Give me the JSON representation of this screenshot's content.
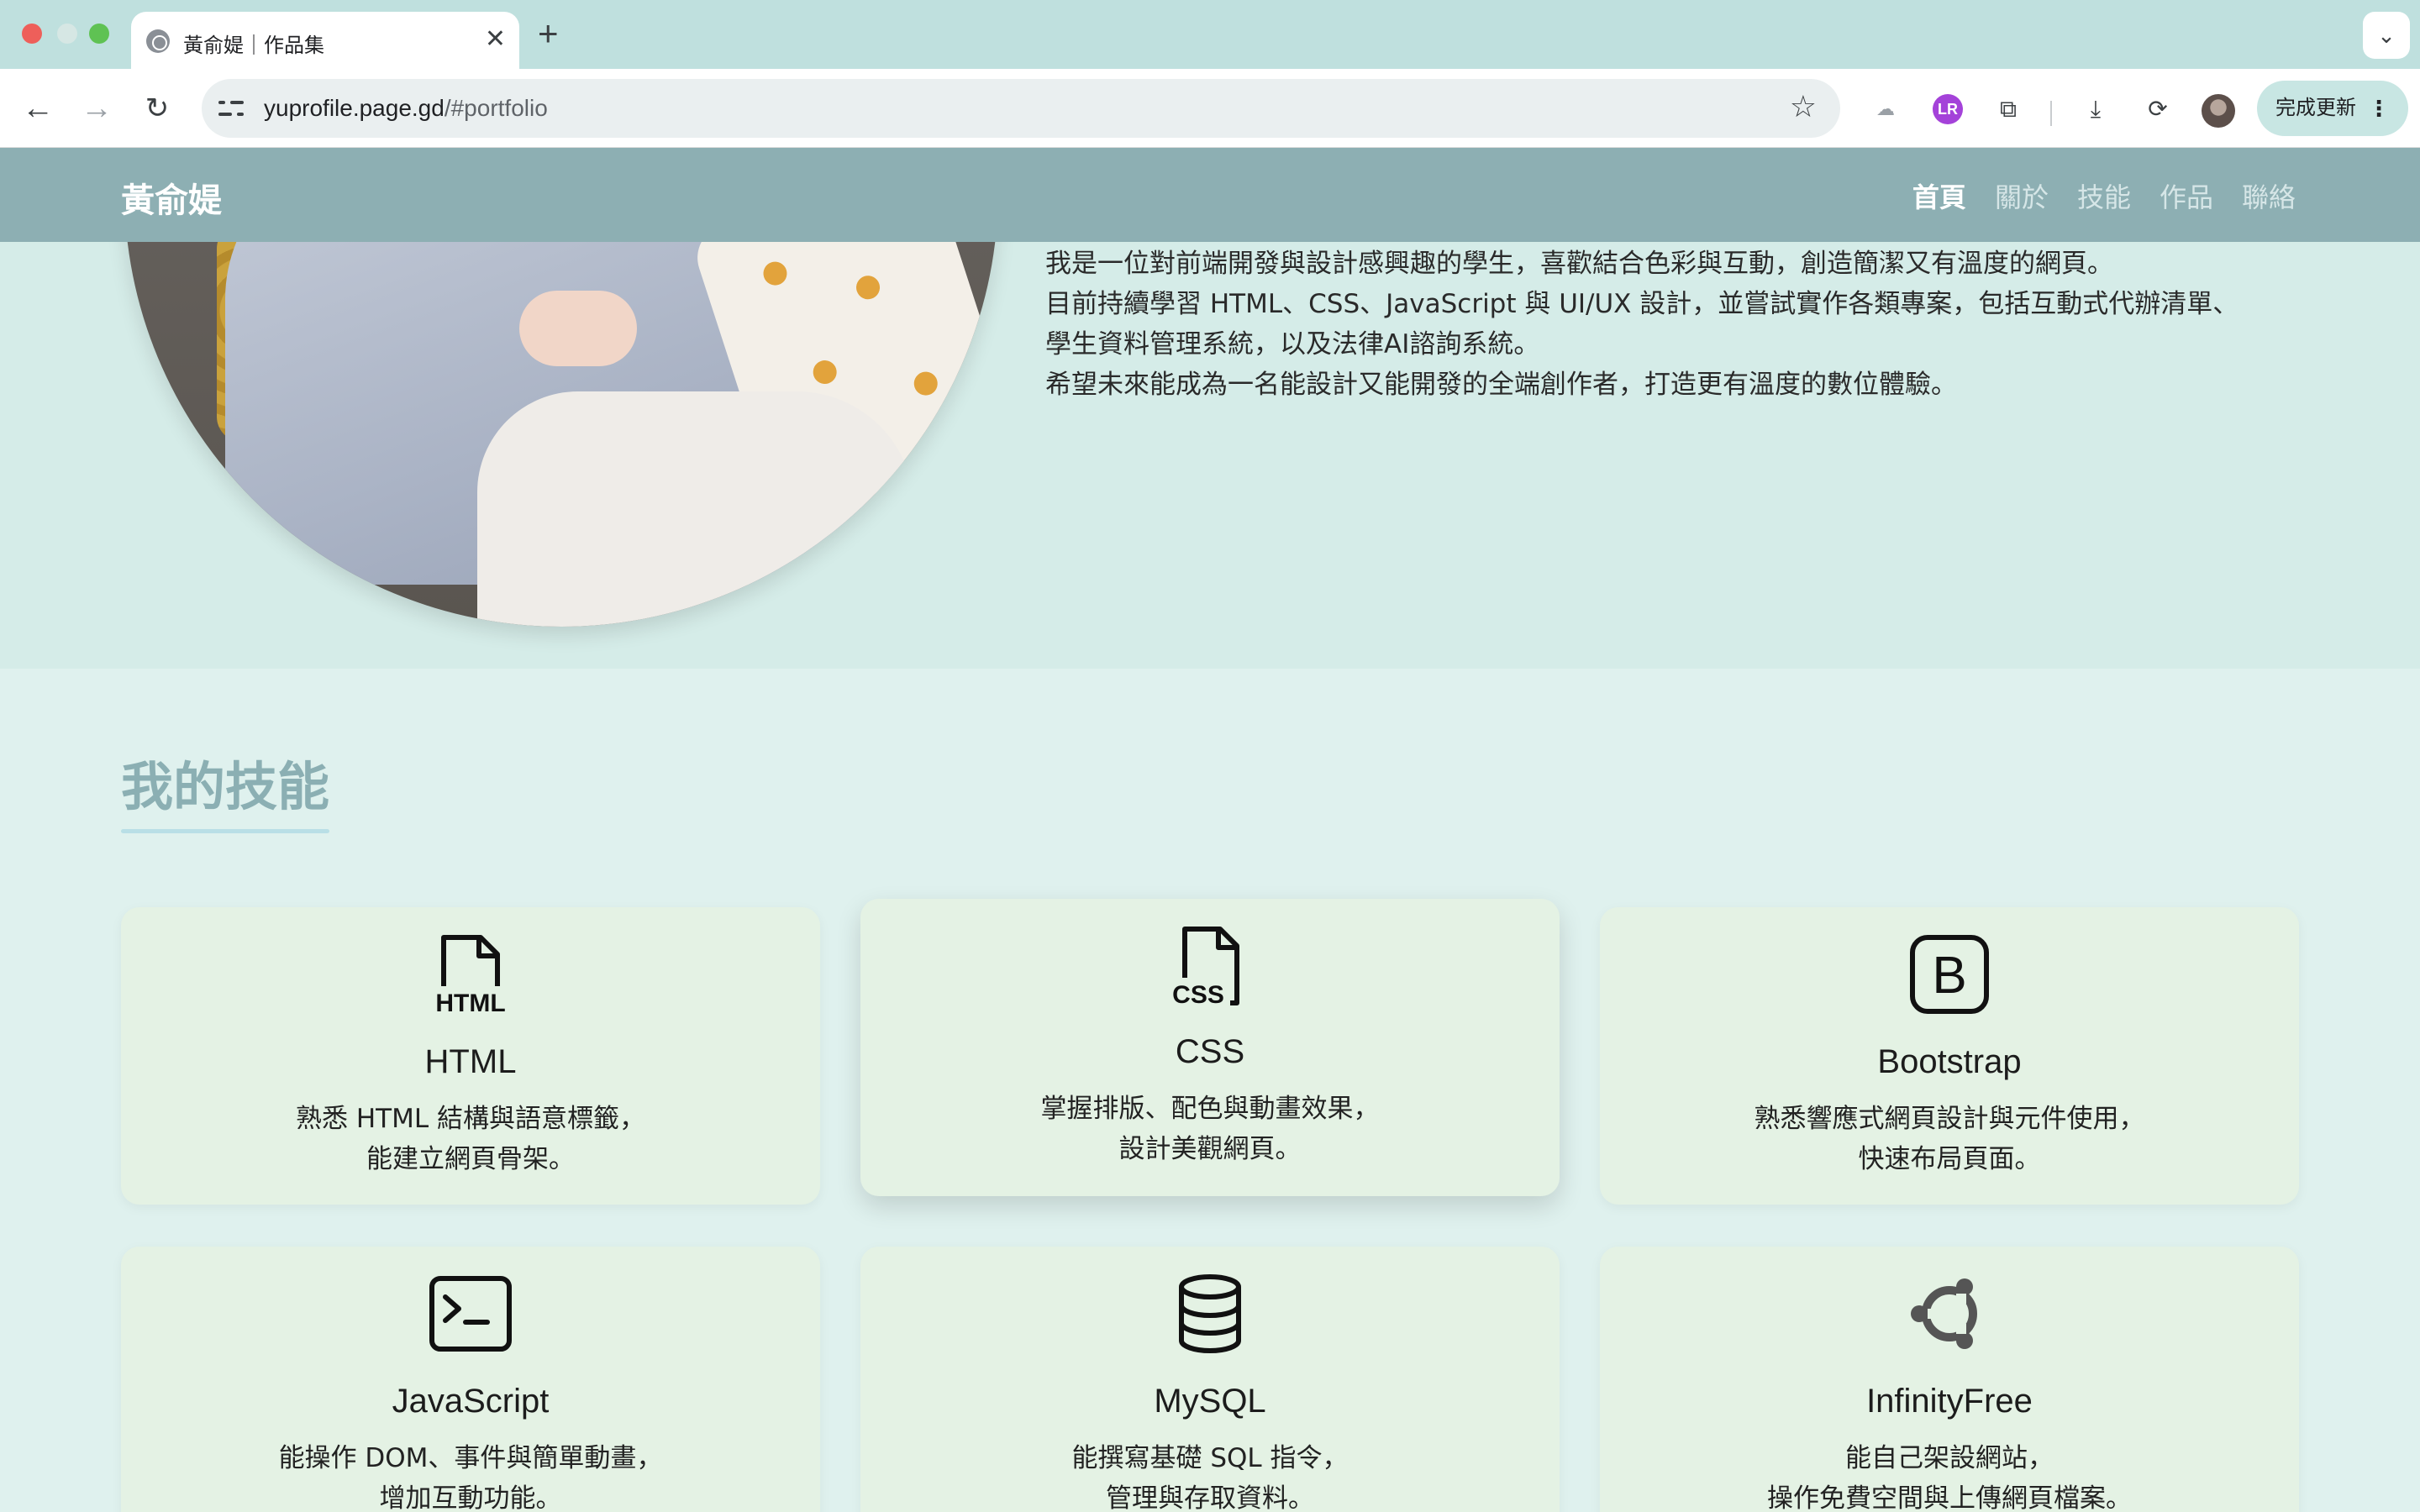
{
  "browser": {
    "tab_title": "黃俞媞｜作品集",
    "tab_close": "✕",
    "new_tab": "+",
    "tab_search": "⌄",
    "url_host": "yuprofile.page.gd",
    "url_path": "/#portfolio",
    "update_label": "完成更新",
    "menu_dots": "⋮",
    "back": "←",
    "forward": "→",
    "reload": "↻",
    "star": "☆",
    "ext_badge": "LR"
  },
  "site": {
    "brand": "黃俞媞",
    "nav": [
      "首頁",
      "關於",
      "技能",
      "作品",
      "聯絡"
    ],
    "active_nav": "首頁"
  },
  "about": {
    "paragraphs": [
      "我是一位對前端開發與設計感興趣的學生，喜歡結合色彩與互動，創造簡潔又有溫度的網頁。",
      "目前持續學習 HTML、CSS、JavaScript 與 UI/UX 設計，並嘗試實作各類專案，包括互動式代辦清單、",
      "學生資料管理系統，以及法律AI諮詢系統。",
      "希望未來能成為一名能設計又能開發的全端創作者，打造更有溫度的數位體驗。"
    ]
  },
  "skills": {
    "title": "我的技能",
    "cards": [
      {
        "name": "HTML",
        "icon": "html-file-icon",
        "desc": [
          "熟悉 HTML 結構與語意標籤，",
          "能建立網頁骨架。"
        ]
      },
      {
        "name": "CSS",
        "icon": "css-file-icon",
        "desc": [
          "掌握排版、配色與動畫效果，",
          "設計美觀網頁。"
        ]
      },
      {
        "name": "Bootstrap",
        "icon": "bootstrap-icon",
        "desc": [
          "熟悉響應式網頁設計與元件使用，",
          "快速布局頁面。"
        ]
      },
      {
        "name": "JavaScript",
        "icon": "terminal-icon",
        "desc": [
          "能操作 DOM、事件與簡單動畫，",
          "增加互動功能。"
        ]
      },
      {
        "name": "MySQL",
        "icon": "database-icon",
        "desc": [
          "能撰寫基礎 SQL 指令，",
          "管理與存取資料。"
        ]
      },
      {
        "name": "InfinityFree",
        "icon": "ubuntu-icon",
        "desc": [
          "能自己架設網站，",
          "操作免費空間與上傳網頁檔案。"
        ]
      }
    ]
  },
  "colors": {
    "nav_bg": "#8dafb3",
    "page_bg": "#dff1ee",
    "card_bg": "#e4f2e4",
    "heading": "#8bafb3"
  }
}
